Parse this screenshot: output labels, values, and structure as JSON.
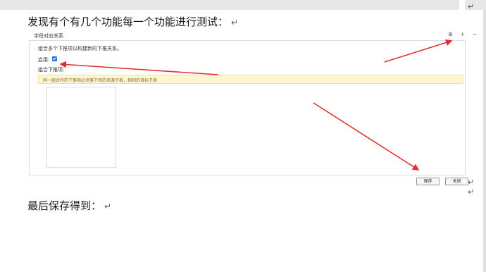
{
  "document": {
    "heading1": "发现有个有几个功能每一个功能进行测试：",
    "heading2": "最后保存得到：",
    "para_mark": "↵"
  },
  "dialog": {
    "title": "字段对应关系",
    "controls": "⊕ + −",
    "description": "组合多个下推项以构建新的下推关系。",
    "enable_label": "启用:",
    "combo_label": "组合下推项:",
    "notice": "同一组合内的下推项必须落下到的来源子表，相同的目标子表",
    "save_button": "保存",
    "close_button": "关闭"
  },
  "colors": {
    "annotation_arrow": "#e03030",
    "panel_border": "#cfe1ef",
    "notice_bg": "#fdf6d2",
    "checkbox": "#2b6fd6"
  }
}
